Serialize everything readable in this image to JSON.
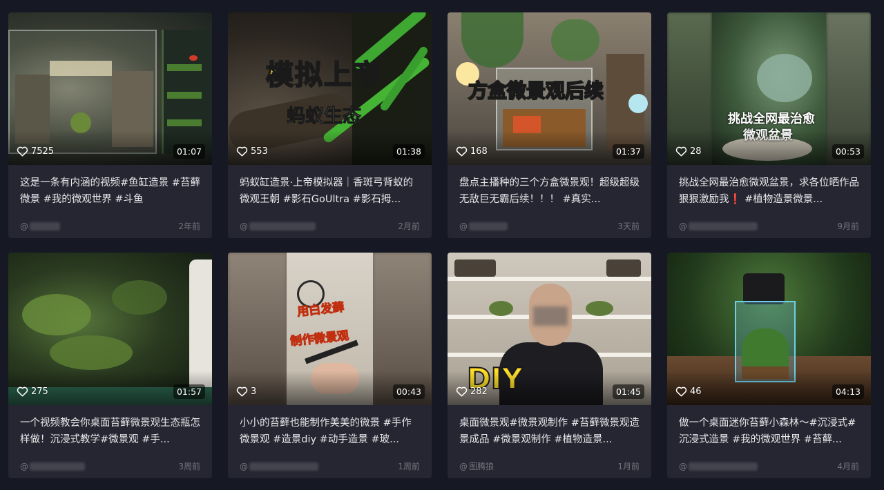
{
  "cards": [
    {
      "likes": "7525",
      "duration": "01:07",
      "title": "这是一条有内涵的视频#鱼缸造景 #苔藓微景 #我的微观世界 #斗鱼",
      "author_prefix": "@",
      "author": "",
      "date": "2年前",
      "overlay": []
    },
    {
      "likes": "553",
      "duration": "01:38",
      "title": "蚂蚁缸造景·上帝模拟器｜香斑弓背蚁的微观王朝 #影石GoUltra #影石拇...",
      "author_prefix": "@",
      "author": "",
      "date": "2月前",
      "overlay": [
        "模拟上帝",
        "蚂蚁生态"
      ]
    },
    {
      "likes": "168",
      "duration": "01:37",
      "title": "盘点主播种的三个方盒微景观！超级超级无敌巨无霸后续！！！ #真实...",
      "author_prefix": "@",
      "author": "",
      "date": "3天前",
      "overlay": [
        "方盒微景观后续"
      ]
    },
    {
      "likes": "28",
      "duration": "00:53",
      "title": "挑战全网最治愈微观盆景，求各位晒作品狠狠激励我❗ #植物造景微景...",
      "author_prefix": "@",
      "author": "",
      "date": "9月前",
      "overlay": [
        "挑战全网最治愈",
        "微观盆景"
      ]
    },
    {
      "likes": "275",
      "duration": "01:57",
      "title": "一个视频教会你桌面苔藓微景观生态瓶怎样做！沉浸式教学#微景观 #手...",
      "author_prefix": "@",
      "author": "",
      "date": "3周前",
      "overlay": []
    },
    {
      "likes": "3",
      "duration": "00:43",
      "title": "小小的苔藓也能制作美美的微景 #手作微景观 #造景diy #动手造景 #玻...",
      "author_prefix": "@",
      "author": "",
      "date": "1周前",
      "overlay": [
        "用白发藓",
        "制作微景观"
      ]
    },
    {
      "likes": "282",
      "duration": "01:45",
      "title": "桌面微景观#微景观制作 #苔藓微景观造景成品 #微景观制作 #植物造景...",
      "author_prefix": "@",
      "author": "图腾狼",
      "date": "1月前",
      "overlay": [
        "DIY"
      ]
    },
    {
      "likes": "46",
      "duration": "04:13",
      "title": "做一个桌面迷你苔藓小森林～#沉浸式#沉浸式造景 #我的微观世界 #苔藓...",
      "author_prefix": "@",
      "author": "",
      "date": "4月前",
      "overlay": []
    }
  ]
}
